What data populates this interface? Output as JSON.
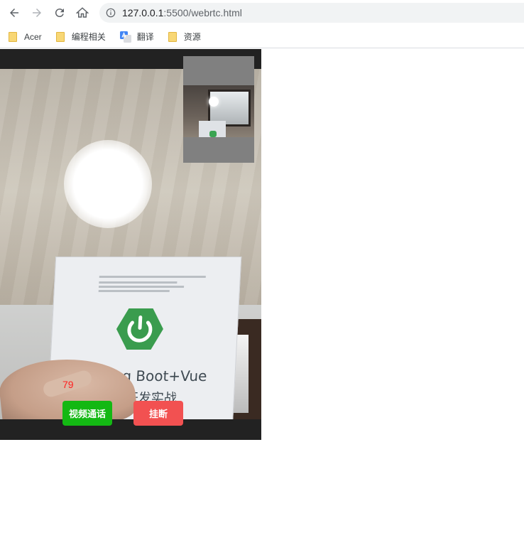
{
  "browser": {
    "url_host": "127.0.0.1",
    "url_rest": ":5500/webrtc.html",
    "icons": {
      "back": "back-arrow-icon",
      "forward": "forward-arrow-icon",
      "reload": "reload-icon",
      "home": "home-icon",
      "info": "info-icon"
    }
  },
  "bookmarks": [
    {
      "label": "Acer",
      "icon": "folder-icon"
    },
    {
      "label": "编程相关",
      "icon": "folder-icon"
    },
    {
      "label": "翻译",
      "icon": "google-translate-icon"
    },
    {
      "label": "资源",
      "icon": "folder-icon"
    }
  ],
  "video": {
    "book_title": "Spring Boot+Vue",
    "book_subtitle": "全栈开发实战",
    "counter": "79"
  },
  "buttons": {
    "call_label": "视频通话",
    "hangup_label": "挂断",
    "call_color": "#13b813",
    "hangup_color": "#f25151"
  }
}
